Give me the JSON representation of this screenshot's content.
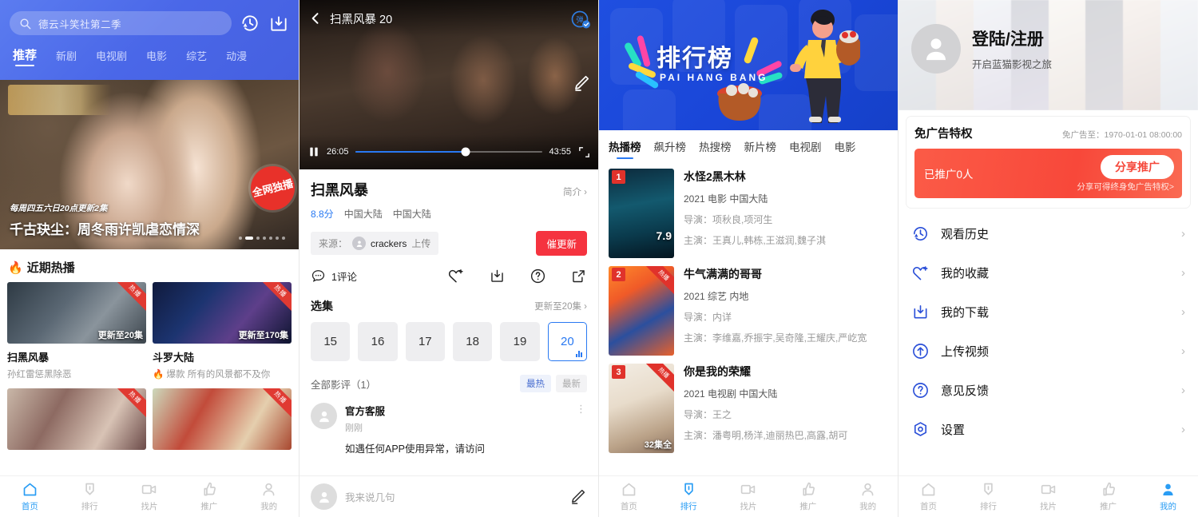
{
  "panel_home": {
    "search": {
      "value": "德云斗笑社第二季",
      "icon": "search-icon"
    },
    "header_icons": [
      "history-icon",
      "download-icon"
    ],
    "tabs": [
      {
        "label": "推荐",
        "active": true
      },
      {
        "label": "新剧",
        "active": false
      },
      {
        "label": "电视剧",
        "active": false
      },
      {
        "label": "电影",
        "active": false
      },
      {
        "label": "综艺",
        "active": false
      },
      {
        "label": "动漫",
        "active": false
      }
    ],
    "hero": {
      "sub": "每周四五六日20点更新2集",
      "title": "千古玦尘：周冬雨许凯虐恋情深",
      "badge": "全网独播",
      "dots_total": 7,
      "dots_active_index": 1
    },
    "section_title": "近期热播",
    "section_icon": "fire-icon",
    "cards": [
      {
        "name": "扫黑风暴",
        "desc": "孙红雷惩黑除恶",
        "corner": "热播",
        "episode": "更新至20集"
      },
      {
        "name": "斗罗大陆",
        "desc": "🔥 爆款 所有的风景都不及你",
        "corner": "热播",
        "episode": "更新至170集"
      },
      {
        "name": "",
        "desc": "",
        "corner": "热播",
        "episode": ""
      },
      {
        "name": "",
        "desc": "",
        "corner": "热播",
        "episode": ""
      }
    ],
    "nav": [
      {
        "label": "首页",
        "icon": "home-icon",
        "active": true
      },
      {
        "label": "排行",
        "icon": "ranking-icon",
        "active": false
      },
      {
        "label": "找片",
        "icon": "video-icon",
        "active": false
      },
      {
        "label": "推广",
        "icon": "thumbsup-icon",
        "active": false
      },
      {
        "label": "我的",
        "icon": "user-icon",
        "active": false
      }
    ]
  },
  "panel_player": {
    "player": {
      "title": "扫黑风暴 20",
      "back_icon": "back-chevron-icon",
      "danmu_icon": "danmaku-icon",
      "pencil_icon": "pencil-icon",
      "pause_icon": "pause-icon",
      "current_time": "26:05",
      "total_time": "43:55",
      "progress_percent": 59,
      "fullscreen_icon": "fullscreen-icon"
    },
    "detail": {
      "title": "扫黑风暴",
      "more": "简介",
      "score": "8.8分",
      "region": "中国大陆",
      "region2": "中国大陆",
      "source_prefix": "来源：",
      "source_user": "crackers",
      "source_suffix": "上传",
      "urge_button": "催更新",
      "comment_count": "1评论",
      "action_icons": [
        "favorite-icon",
        "download-icon",
        "help-icon",
        "share-icon"
      ]
    },
    "episodes": {
      "label": "选集",
      "update_text": "更新至20集",
      "items": [
        {
          "num": "15",
          "active": false
        },
        {
          "num": "16",
          "active": false
        },
        {
          "num": "17",
          "active": false
        },
        {
          "num": "18",
          "active": false
        },
        {
          "num": "19",
          "active": false
        },
        {
          "num": "20",
          "active": true
        }
      ]
    },
    "reviews": {
      "title": "全部影评",
      "count": "（1）",
      "sort_hot": "最热",
      "sort_new": "最新",
      "items": [
        {
          "name": "官方客服",
          "time": "刚刚",
          "text": "如遇任何APP使用异常，请访问"
        }
      ],
      "input_placeholder": "我来说几句",
      "input_icon": "pencil-icon"
    }
  },
  "panel_rank": {
    "banner": {
      "title": "排行榜",
      "subtitle": "PAI HANG BANG"
    },
    "tabs": [
      {
        "label": "热播榜",
        "active": true
      },
      {
        "label": "飙升榜",
        "active": false
      },
      {
        "label": "热搜榜",
        "active": false
      },
      {
        "label": "新片榜",
        "active": false
      },
      {
        "label": "电视剧",
        "active": false
      },
      {
        "label": "电影",
        "active": false
      }
    ],
    "items": [
      {
        "rank": "1",
        "corner": "",
        "name": "水怪2黑木林",
        "meta": "2021  电影  中国大陆",
        "director": "导演：项秋良,项河生",
        "cast": "主演：王真儿,韩栋,王滋润,魏子淇",
        "score": "7.9",
        "episodes": ""
      },
      {
        "rank": "2",
        "corner": "热播",
        "name": "牛气满满的哥哥",
        "meta": "2021  综艺  内地",
        "director": "导演：内详",
        "cast": "主演：李维嘉,乔振宇,吴奇隆,王耀庆,严屹宽",
        "score": "",
        "episodes": ""
      },
      {
        "rank": "3",
        "corner": "热播",
        "name": "你是我的荣耀",
        "meta": "2021  电视剧  中国大陆",
        "director": "导演：王之",
        "cast": "主演：潘粤明,杨洋,迪丽热巴,高露,胡可",
        "score": "",
        "episodes": "32集全"
      }
    ],
    "nav": [
      {
        "label": "首页",
        "icon": "home-icon",
        "active": false
      },
      {
        "label": "排行",
        "icon": "ranking-icon",
        "active": true
      },
      {
        "label": "找片",
        "icon": "video-icon",
        "active": false
      },
      {
        "label": "推广",
        "icon": "thumbsup-icon",
        "active": false
      },
      {
        "label": "我的",
        "icon": "user-icon",
        "active": false
      }
    ]
  },
  "panel_profile": {
    "user": {
      "name": "登陆/注册",
      "desc": "开启蓝猫影视之旅",
      "avatar_icon": "user-avatar-icon"
    },
    "ad_card": {
      "title": "免广告特权",
      "expiry": "免广告至：1970-01-01 08:00:00",
      "promoted": "已推广0人",
      "share_button": "分享推广",
      "share_note": "分享可得终身免广告特权>"
    },
    "menu": [
      {
        "label": "观看历史",
        "icon": "history-icon"
      },
      {
        "label": "我的收藏",
        "icon": "favorite-icon"
      },
      {
        "label": "我的下载",
        "icon": "download-icon"
      },
      {
        "label": "上传视频",
        "icon": "upload-icon"
      },
      {
        "label": "意见反馈",
        "icon": "help-icon"
      },
      {
        "label": "设置",
        "icon": "gear-icon"
      }
    ],
    "nav": [
      {
        "label": "首页",
        "icon": "home-icon",
        "active": false
      },
      {
        "label": "排行",
        "icon": "ranking-icon",
        "active": false
      },
      {
        "label": "找片",
        "icon": "video-icon",
        "active": false
      },
      {
        "label": "推广",
        "icon": "thumbsup-icon",
        "active": false
      },
      {
        "label": "我的",
        "icon": "user-icon",
        "active": true
      }
    ]
  },
  "colors": {
    "brand_blue": "#2979f2",
    "header_blue": "#4a67e8",
    "banner_blue": "#1a46d8",
    "accent_red": "#f5333f",
    "promo_red": "#f8483a",
    "nav_active": "#2a9df4"
  }
}
